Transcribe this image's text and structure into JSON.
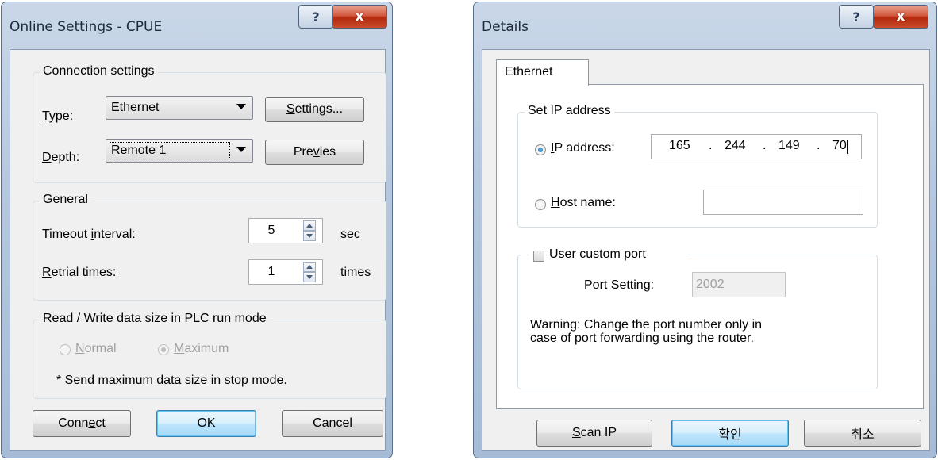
{
  "online_settings": {
    "title": "Online Settings - CPUE",
    "help_glyph": "?",
    "close_glyph": "x",
    "connection": {
      "group_label": "Connection settings",
      "type_label_u": "T",
      "type_label_rest": "ype:",
      "type_value": "Ethernet",
      "settings_button_u": "S",
      "settings_button_rest": "ettings...",
      "depth_label_u": "D",
      "depth_label_rest": "epth:",
      "depth_value": "Remote 1",
      "preview_button_a": "Pre",
      "preview_button_u": "v",
      "preview_button_b": "ies"
    },
    "general": {
      "group_label": "General",
      "timeout_label_a": "Timeout ",
      "timeout_label_u": "i",
      "timeout_label_b": "nterval:",
      "timeout_value": "5",
      "timeout_unit": "sec",
      "retrial_label_u": "R",
      "retrial_label_rest": "etrial times:",
      "retrial_value": "1",
      "retrial_unit": "times"
    },
    "rw_size": {
      "group_label": "Read / Write data size in PLC run mode",
      "normal_u": "N",
      "normal_rest": "ormal",
      "maximum_u": "M",
      "maximum_rest": "aximum",
      "selected": "Maximum",
      "note": "* Send maximum data size in stop mode."
    },
    "buttons": {
      "connect_a": "Conn",
      "connect_u": "e",
      "connect_b": "ct",
      "ok": "OK",
      "cancel": "Cancel"
    }
  },
  "details": {
    "title": "Details",
    "help_glyph": "?",
    "close_glyph": "x",
    "tab_label": "Ethernet",
    "ip_group_label": "Set IP address",
    "ip_option_u": "I",
    "ip_option_rest": "P address:",
    "ip_octets": [
      "165",
      "244",
      "149",
      "70"
    ],
    "ip_sep": ".",
    "host_option_u": "H",
    "host_option_rest": "ost name:",
    "host_value": "",
    "selected": "IP address",
    "custom_port_label": "User custom port",
    "custom_port_checked": false,
    "port_label": "Port Setting:",
    "port_value": "2002",
    "warning_line1": "Warning: Change the port number only in",
    "warning_line2": "case of port forwarding using the router.",
    "buttons": {
      "scan_u": "S",
      "scan_rest": "can IP",
      "ok": "확인",
      "cancel": "취소"
    }
  }
}
